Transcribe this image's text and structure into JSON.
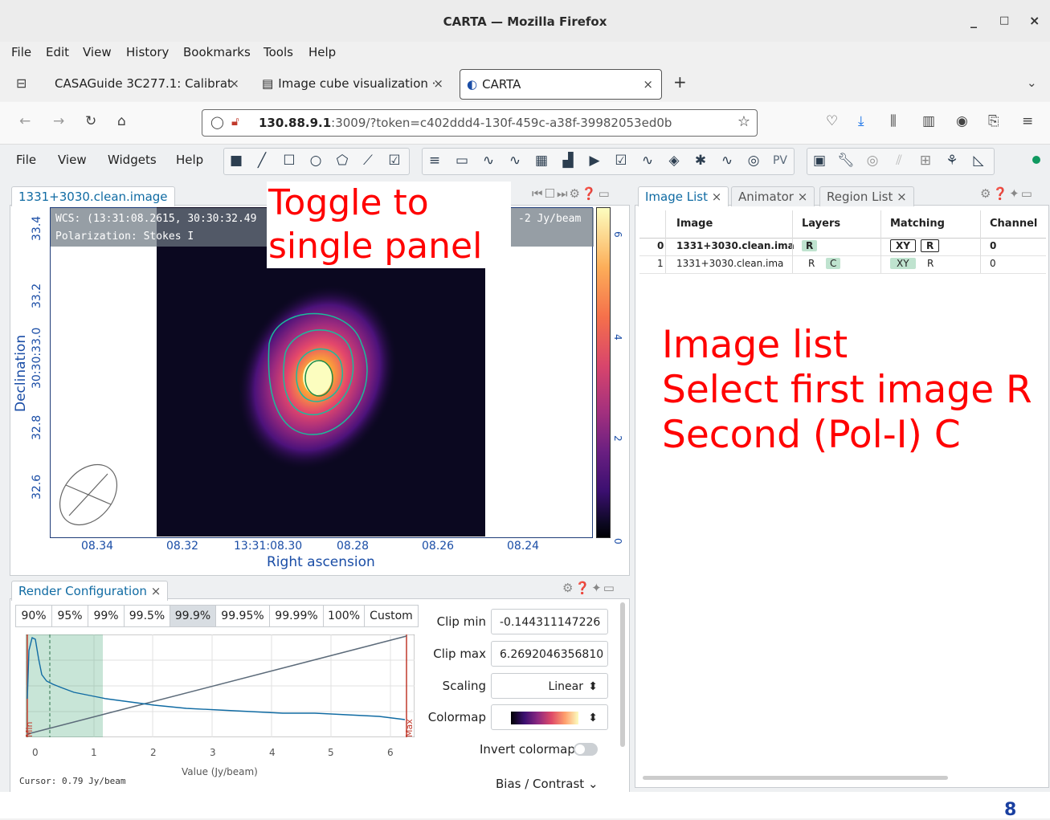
{
  "window": {
    "title": "CARTA — Mozilla Firefox",
    "controls": [
      "_",
      "□",
      "×"
    ]
  },
  "menubar": [
    "File",
    "Edit",
    "View",
    "History",
    "Bookmarks",
    "Tools",
    "Help"
  ],
  "tabs": [
    {
      "label": "CASAGuide 3C277.1: Calibrat",
      "close": "×"
    },
    {
      "label": "Image cube visualization ·",
      "close": "×"
    },
    {
      "label": "CARTA",
      "close": "×"
    }
  ],
  "new_tab": "+",
  "url": {
    "host": "130.88.9.1",
    "rest": ":3009/?token=c402ddd4-130f-459c-a38f-39982053ed0b"
  },
  "carta_menu": [
    "File",
    "View",
    "Widgets",
    "Help"
  ],
  "toolbar_pv": "PV",
  "viewer": {
    "tab": "1331+3030.clean.image",
    "wcs_line": "WCS: (13:31:08.2615, 30:30:32.49",
    "pol_line": "Polarization: Stokes I",
    "unit_line": "-2 Jy/beam",
    "ylabel": "Declination",
    "xlabel": "Right ascension",
    "yticks": [
      "33.4",
      "33.2",
      "30:30:33.0",
      "32.8",
      "32.6"
    ],
    "xticks": [
      "08.34",
      "08.32",
      "13:31:08.30",
      "08.28",
      "08.26",
      "08.24"
    ],
    "cbticks": [
      "6",
      "4",
      "2",
      "0"
    ]
  },
  "right_panel": {
    "tabs": [
      "Image List",
      "Animator",
      "Region List"
    ],
    "headers": [
      "Image",
      "Layers",
      "Matching",
      "Channel"
    ],
    "rows": [
      {
        "idx": "0",
        "name": "1331+3030.clean.ima",
        "layers": [
          "R"
        ],
        "matching": [
          "XY",
          "R"
        ],
        "channel": "0"
      },
      {
        "idx": "1",
        "name": "1331+3030.clean.ima",
        "layers": [
          "R",
          "C"
        ],
        "matching": [
          "XY",
          "R"
        ],
        "channel": "0"
      }
    ]
  },
  "annotations": {
    "toggle": [
      "Toggle to",
      "single panel"
    ],
    "image_list": [
      "Image list",
      "Select first image R",
      "Second (Pol-I) C"
    ]
  },
  "render": {
    "tab": "Render Configuration",
    "percentiles": [
      "90%",
      "95%",
      "99%",
      "99.5%",
      "99.9%",
      "99.95%",
      "99.99%",
      "100%",
      "Custom"
    ],
    "selected": "99.9%",
    "clip_min_label": "Clip min",
    "clip_min": "-0.144311147226",
    "clip_max_label": "Clip max",
    "clip_max": "6.2692046356810",
    "scaling_label": "Scaling",
    "scaling": "Linear",
    "colormap_label": "Colormap",
    "invert_label": "Invert colormap",
    "bias_label": "Bias / Contrast",
    "cursor": "Cursor: 0.79 Jy/beam",
    "hist_xlabel": "Value (Jy/beam)",
    "hist_xticks": [
      "0",
      "1",
      "2",
      "3",
      "4",
      "5",
      "6"
    ],
    "min_label": "Min",
    "max_label": "Max"
  },
  "colors": {
    "accent": "#106ba3",
    "annotation": "#ff0000",
    "tag_green": "#bfe3cf"
  }
}
